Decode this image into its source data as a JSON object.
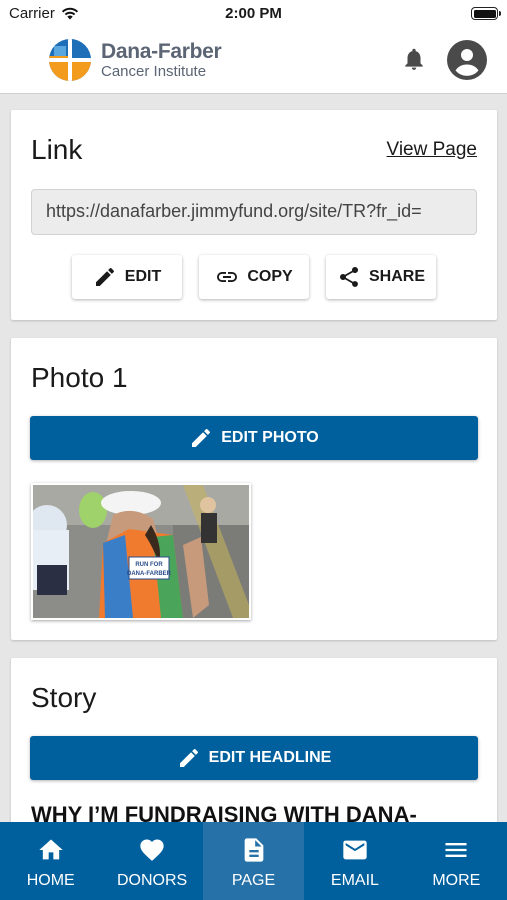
{
  "status_bar": {
    "carrier": "Carrier",
    "time": "2:00 PM"
  },
  "header": {
    "logo_name": "Dana-Farber",
    "logo_sub": "Cancer Institute",
    "bell_icon": "bell-icon",
    "profile_icon": "account-circle-icon"
  },
  "link_card": {
    "title": "Link",
    "view_page": "View Page",
    "url": "https://danafarber.jimmyfund.org/site/TR?fr_id=",
    "actions": [
      {
        "label": "EDIT",
        "icon": "pencil-icon"
      },
      {
        "label": "COPY",
        "icon": "link-icon"
      },
      {
        "label": "SHARE",
        "icon": "share-icon"
      }
    ]
  },
  "photo_card": {
    "title": "Photo 1",
    "edit_label": "EDIT PHOTO",
    "photo_sign": "RUN FOR DANA-FARBER"
  },
  "story_card": {
    "title": "Story",
    "edit_label": "EDIT HEADLINE",
    "headline": "WHY I’M FUNDRAISING WITH DANA-"
  },
  "bottom_nav": {
    "items": [
      {
        "label": "HOME",
        "icon": "home-icon"
      },
      {
        "label": "DONORS",
        "icon": "heart-icon"
      },
      {
        "label": "PAGE",
        "icon": "page-icon",
        "active": true
      },
      {
        "label": "EMAIL",
        "icon": "envelope-icon"
      },
      {
        "label": "MORE",
        "icon": "menu-icon"
      }
    ]
  },
  "colors": {
    "primary": "#00609e",
    "nav_active": "#2672a8",
    "logo_blue": "#1e6fb8",
    "logo_orange": "#f29b1d"
  }
}
